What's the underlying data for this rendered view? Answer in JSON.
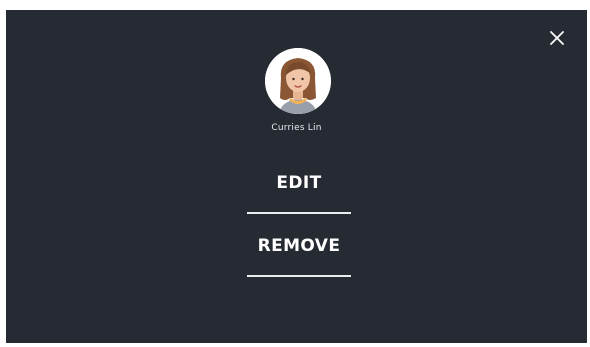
{
  "dialog": {
    "user": {
      "name": "Curries Lin"
    },
    "actions": {
      "edit_label": "EDIT",
      "remove_label": "REMOVE"
    }
  },
  "colors": {
    "backdrop": "#262b33",
    "text": "#ffffff",
    "divider": "#e9ebef",
    "avatar_hair": "#8a5634",
    "avatar_skin": "#f1c6a8",
    "avatar_necklace": "#f0b35a"
  },
  "icons": {
    "close": "close-icon",
    "avatar": "avatar-icon"
  }
}
